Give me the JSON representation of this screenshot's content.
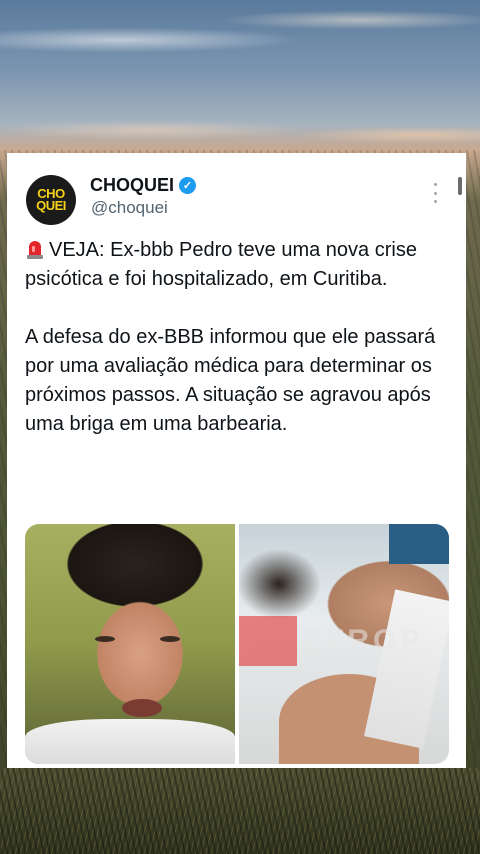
{
  "account": {
    "avatar_text_top": "CHO",
    "avatar_text_bottom": "QUEI",
    "name": "CHOQUEI",
    "handle": "@choquei",
    "verified": true
  },
  "tweet": {
    "paragraph1": "VEJA: Ex-bbb Pedro teve uma nova crise psicótica e foi hospitalizado, em Curitiba.",
    "paragraph2": "A defesa do ex-BBB informou que ele passará por uma avaliação médica para determinar os próximos passos. A situação se agravou após uma briga em uma barbearia."
  },
  "media": {
    "watermark_text": "ETROP"
  },
  "colors": {
    "verified_blue": "#1d9bf0",
    "avatar_yellow": "#f6d21b",
    "text_primary": "#0f1419",
    "text_secondary": "#536471"
  }
}
